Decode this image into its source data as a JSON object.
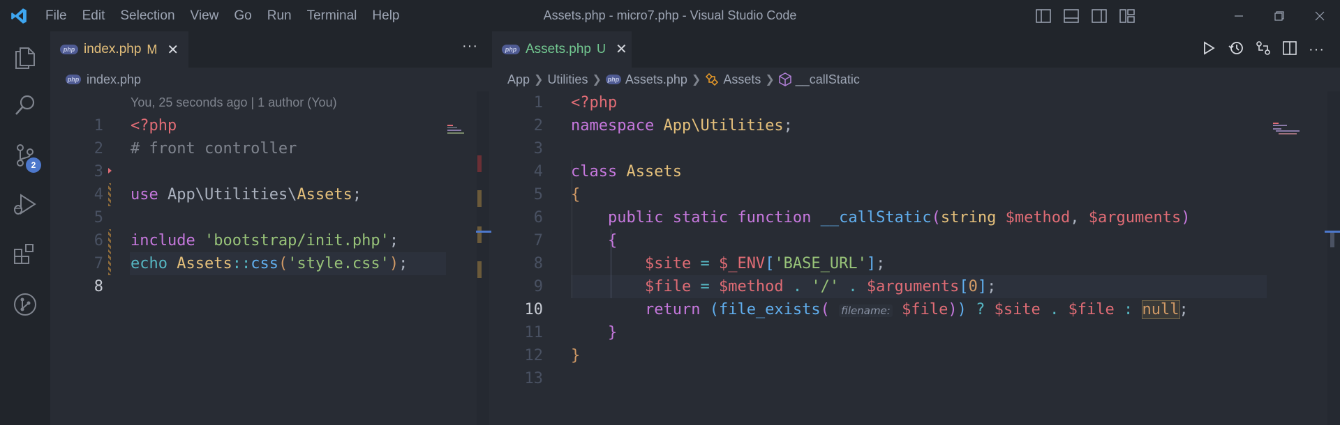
{
  "window": {
    "title": "Assets.php - micro7.php - Visual Studio Code",
    "menu": [
      "File",
      "Edit",
      "Selection",
      "View",
      "Go",
      "Run",
      "Terminal",
      "Help"
    ]
  },
  "activity_bar": {
    "items": [
      "explorer-icon",
      "search-icon",
      "source-control-icon",
      "run-debug-icon",
      "extensions-icon",
      "git-graph-icon"
    ],
    "source_control_badge": "2"
  },
  "left_editor": {
    "tab": {
      "label": "index.php",
      "status": "M",
      "badge": "php",
      "close": "✕"
    },
    "more_actions": "···",
    "breadcrumb": {
      "file": "index.php",
      "badge": "php"
    },
    "blame": "You, 25 seconds ago | 1 author (You)",
    "line_numbers": [
      "1",
      "2",
      "3",
      "4",
      "5",
      "6",
      "7",
      "8"
    ],
    "active_line": 8
  },
  "right_editor": {
    "tab": {
      "label": "Assets.php",
      "status": "U",
      "badge": "php",
      "close": "✕"
    },
    "breadcrumb": {
      "part1": "App",
      "part2": "Utilities",
      "part3": "Assets.php",
      "part4": "Assets",
      "part5": "__callStatic",
      "badge": "php"
    },
    "line_numbers": [
      "1",
      "2",
      "3",
      "4",
      "5",
      "6",
      "7",
      "8",
      "9",
      "10",
      "11",
      "12",
      "13"
    ],
    "active_line": 10,
    "inlay_hint": "filename:"
  },
  "colors": {
    "accent": "#4d78cc",
    "tab_modified": "#e5c07b",
    "tab_untracked": "#73c991"
  }
}
